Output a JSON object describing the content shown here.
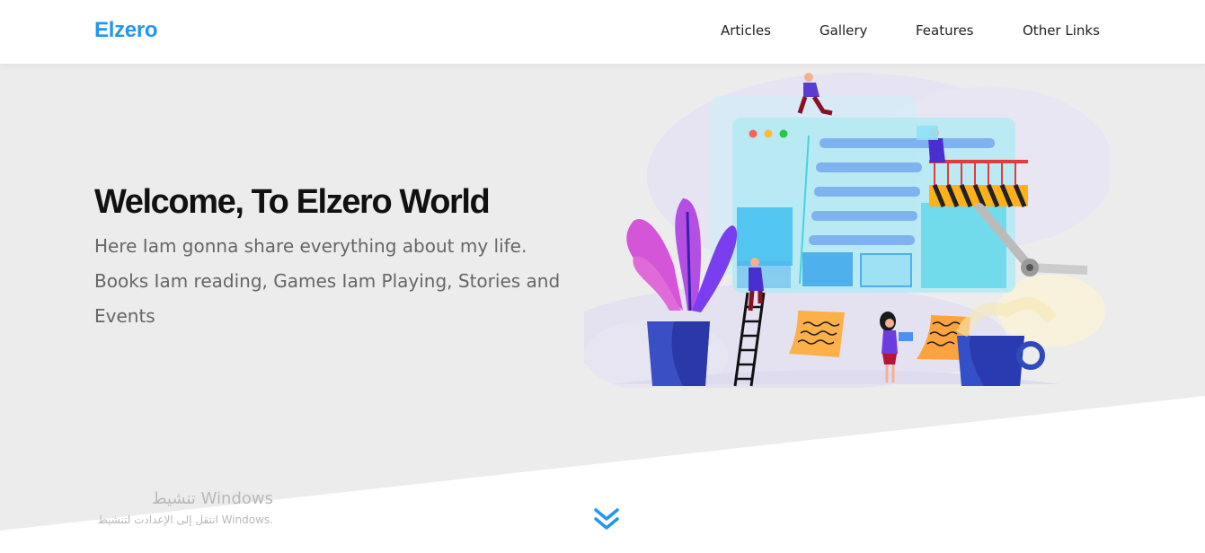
{
  "header": {
    "logo": "Elzero",
    "nav": [
      {
        "label": "Articles"
      },
      {
        "label": "Gallery"
      },
      {
        "label": "Features"
      },
      {
        "label": "Other Links"
      }
    ]
  },
  "landing": {
    "title": "Welcome, To Elzero World",
    "description": "Here Iam gonna share everything about my life. Books Iam reading, Games Iam Playing, Stories and Events"
  },
  "watermark": {
    "line1": "تنشيط Windows",
    "line2": "انتقل إلى الإعدادت لتنشيط Windows."
  },
  "colors": {
    "brand": "#2196f3",
    "landing_bg": "#ececec"
  },
  "icons": {
    "scroll": "double-chevron-down-icon"
  }
}
